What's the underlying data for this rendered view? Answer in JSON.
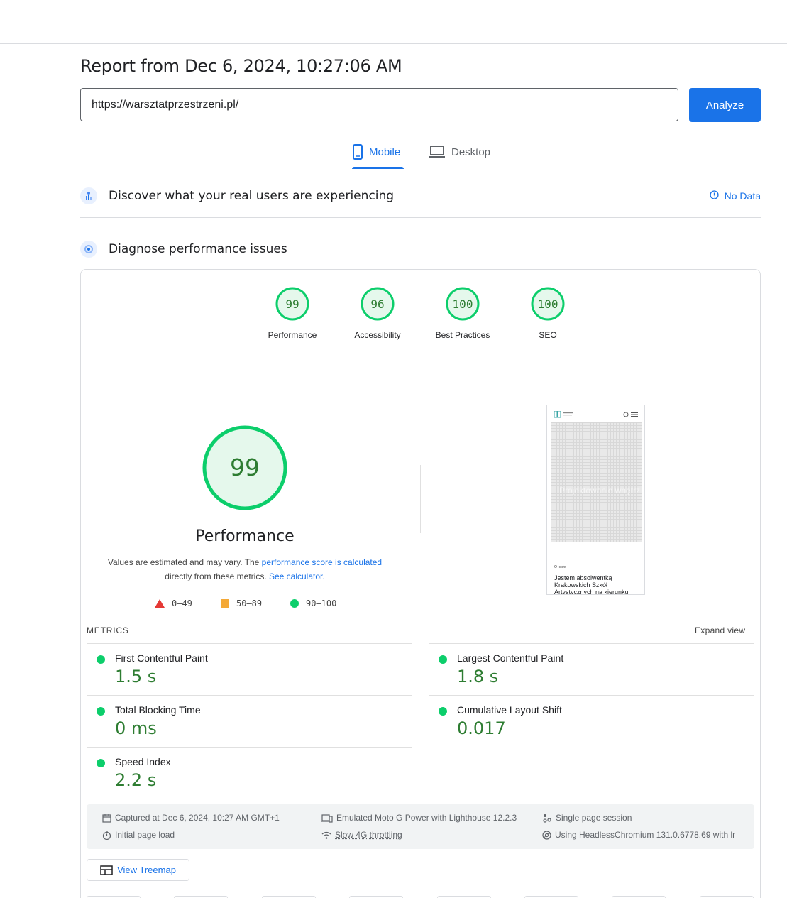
{
  "report": {
    "title": "Report from Dec 6, 2024, 10:27:06 AM",
    "url_value": "https://warsztatprzestrzeni.pl/",
    "analyze_label": "Analyze"
  },
  "tabs": [
    {
      "label": "Mobile",
      "icon": "phone-icon",
      "active": true
    },
    {
      "label": "Desktop",
      "icon": "laptop-icon",
      "active": false
    }
  ],
  "crux": {
    "heading": "Discover what your real users are experiencing",
    "status": "No Data"
  },
  "diagnose": {
    "heading": "Diagnose performance issues"
  },
  "scores": [
    {
      "label": "Performance",
      "value": 99
    },
    {
      "label": "Accessibility",
      "value": 96
    },
    {
      "label": "Best Practices",
      "value": 100
    },
    {
      "label": "SEO",
      "value": 100
    }
  ],
  "performance": {
    "score": 99,
    "title": "Performance",
    "desc_1": "Values are estimated and may vary. The ",
    "desc_link_1": "performance score is calculated",
    "desc_2": "directly from these metrics. ",
    "desc_link_2": "See calculator."
  },
  "legend": [
    {
      "range": "0–49",
      "shape": "triangle",
      "color": "#e53935"
    },
    {
      "range": "50–89",
      "shape": "square",
      "color": "#f4a937"
    },
    {
      "range": "90–100",
      "shape": "circle",
      "color": "#0cce6b"
    }
  ],
  "screenshot": {
    "hero_text": "Projektowanie wnętrz",
    "section_label": "O mnie",
    "body_text": "Jestem absolwentką Krakowskich Szkół Artystycznych na kierunku"
  },
  "metrics": {
    "label": "METRICS",
    "expand_label": "Expand view",
    "items": [
      {
        "name": "First Contentful Paint",
        "value": "1.5 s"
      },
      {
        "name": "Largest Contentful Paint",
        "value": "1.8 s"
      },
      {
        "name": "Total Blocking Time",
        "value": "0 ms"
      },
      {
        "name": "Cumulative Layout Shift",
        "value": "0.017"
      },
      {
        "name": "Speed Index",
        "value": "2.2 s"
      }
    ]
  },
  "info": {
    "captured": "Captured at Dec 6, 2024, 10:27 AM GMT+1",
    "initial_load": "Initial page load",
    "device": "Emulated Moto G Power with Lighthouse 12.2.3",
    "throttling": "Slow 4G throttling",
    "session": "Single page session",
    "browser": "Using HeadlessChromium 131.0.6778.69 with lr"
  },
  "treemap": {
    "label": "View Treemap"
  },
  "colors": {
    "accent": "#1a73e8",
    "pass": "#0cce6b",
    "pass_text": "#2e7d32",
    "gauge_fill": "#e5f8ec"
  }
}
